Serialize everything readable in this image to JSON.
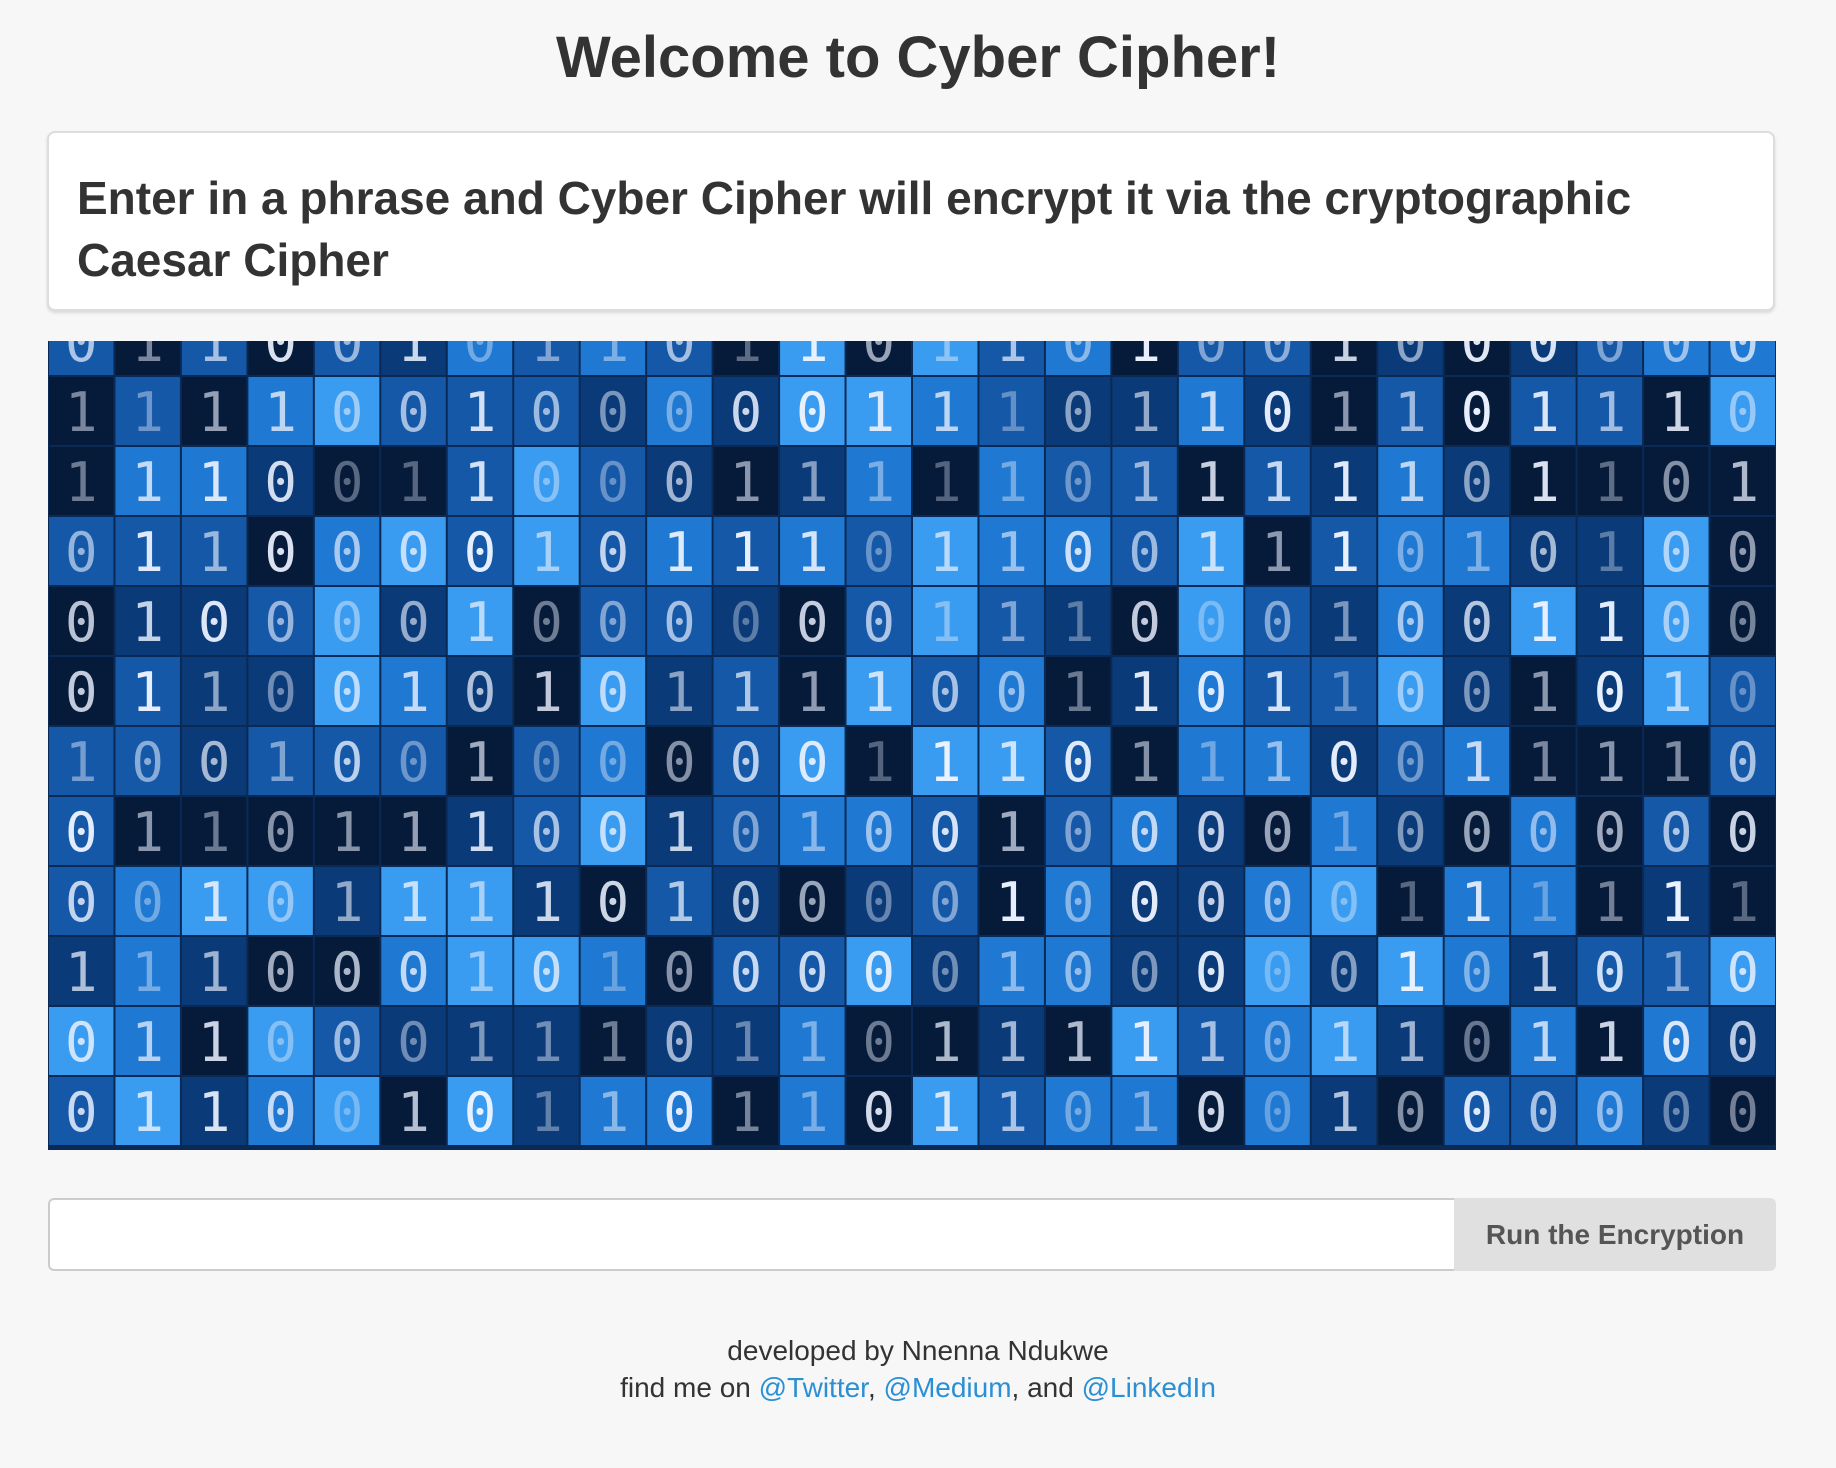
{
  "header": {
    "title": "Welcome to Cyber Cipher!"
  },
  "intro": {
    "text": "Enter in a phrase and Cyber Cipher will encrypt it via the cryptographic Caesar Cipher"
  },
  "hero_image": {
    "semantic": "binary-code-image",
    "digit_rows": [
      "01100101101101101001000000",
      "11110010000011101101101110",
      "11100110001111101111101101",
      "01100001011101100111010100",
      "01000010000001110001001100",
      "01100101011110011011001010",
      "10010010000011101110011110",
      "01101110010100100001000000",
      "00101111010000100000111111",
      "11100010100000100000101010",
      "01100011101101111101101100"
    ],
    "colors": {
      "deep": "#061a3a",
      "dark": "#0b3a78",
      "mid": "#1558a8",
      "light": "#1f78d1",
      "bright": "#3a9cf0"
    }
  },
  "form": {
    "input_value": "",
    "input_placeholder": "",
    "button_label": "Run the Encryption"
  },
  "footer": {
    "developed_by": "developed by Nnenna Ndukwe",
    "find_me_prefix": "find me on ",
    "separator_1": ", ",
    "separator_2": ", and ",
    "twitter_label": "@Twitter",
    "medium_label": "@Medium",
    "linkedin_label": "@LinkedIn",
    "link_color": "#2a8fd4"
  },
  "colors": {
    "background": "#f7f7f7",
    "text": "#333333",
    "button_bg": "#e0e0e0"
  }
}
